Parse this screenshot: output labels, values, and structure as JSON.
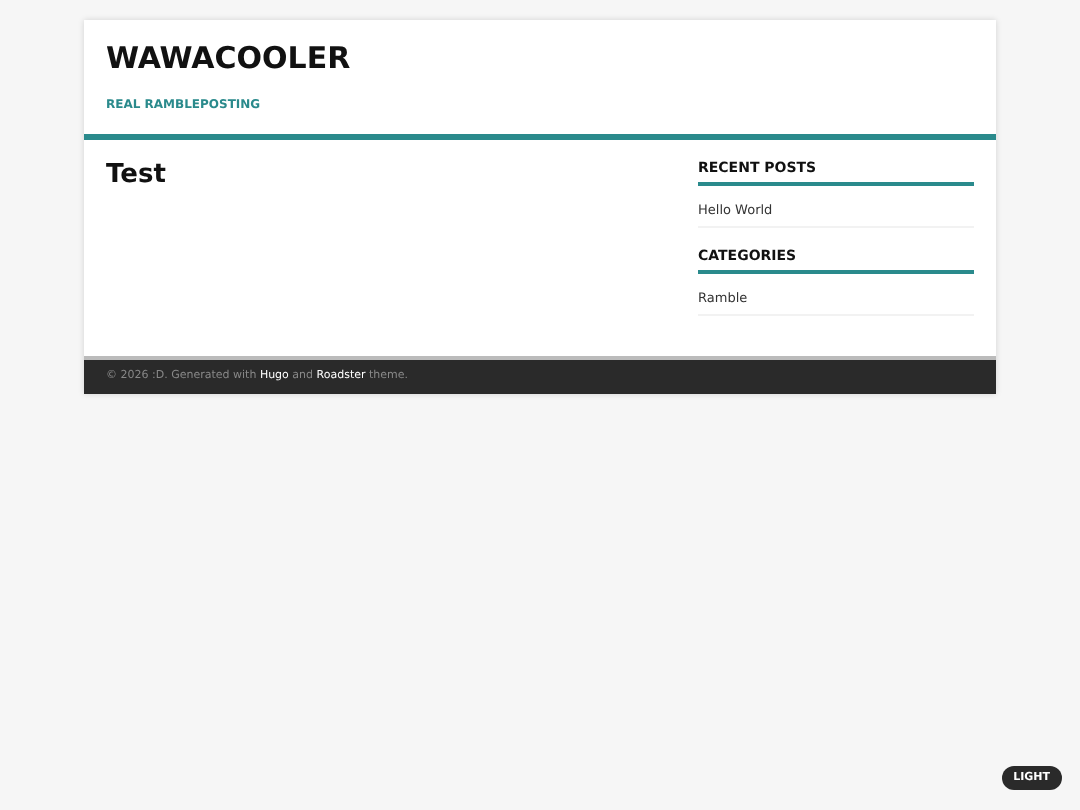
{
  "header": {
    "title": "WAWACOOLER",
    "tagline": "REAL RAMBLEPOSTING"
  },
  "main": {
    "title": "Test"
  },
  "sidebar": [
    {
      "heading": "RECENT POSTS",
      "items": [
        "Hello World"
      ]
    },
    {
      "heading": "CATEGORIES",
      "items": [
        "Ramble"
      ]
    }
  ],
  "footer": {
    "parts": [
      {
        "kind": "text",
        "text": "© 2026 :D. Generated with"
      },
      {
        "kind": "link",
        "text": "Hugo"
      },
      {
        "kind": "text",
        "text": "and"
      },
      {
        "kind": "link",
        "text": "Roadster"
      },
      {
        "kind": "text",
        "text": "theme."
      }
    ]
  },
  "theme_button": {
    "label": "LIGHT"
  }
}
